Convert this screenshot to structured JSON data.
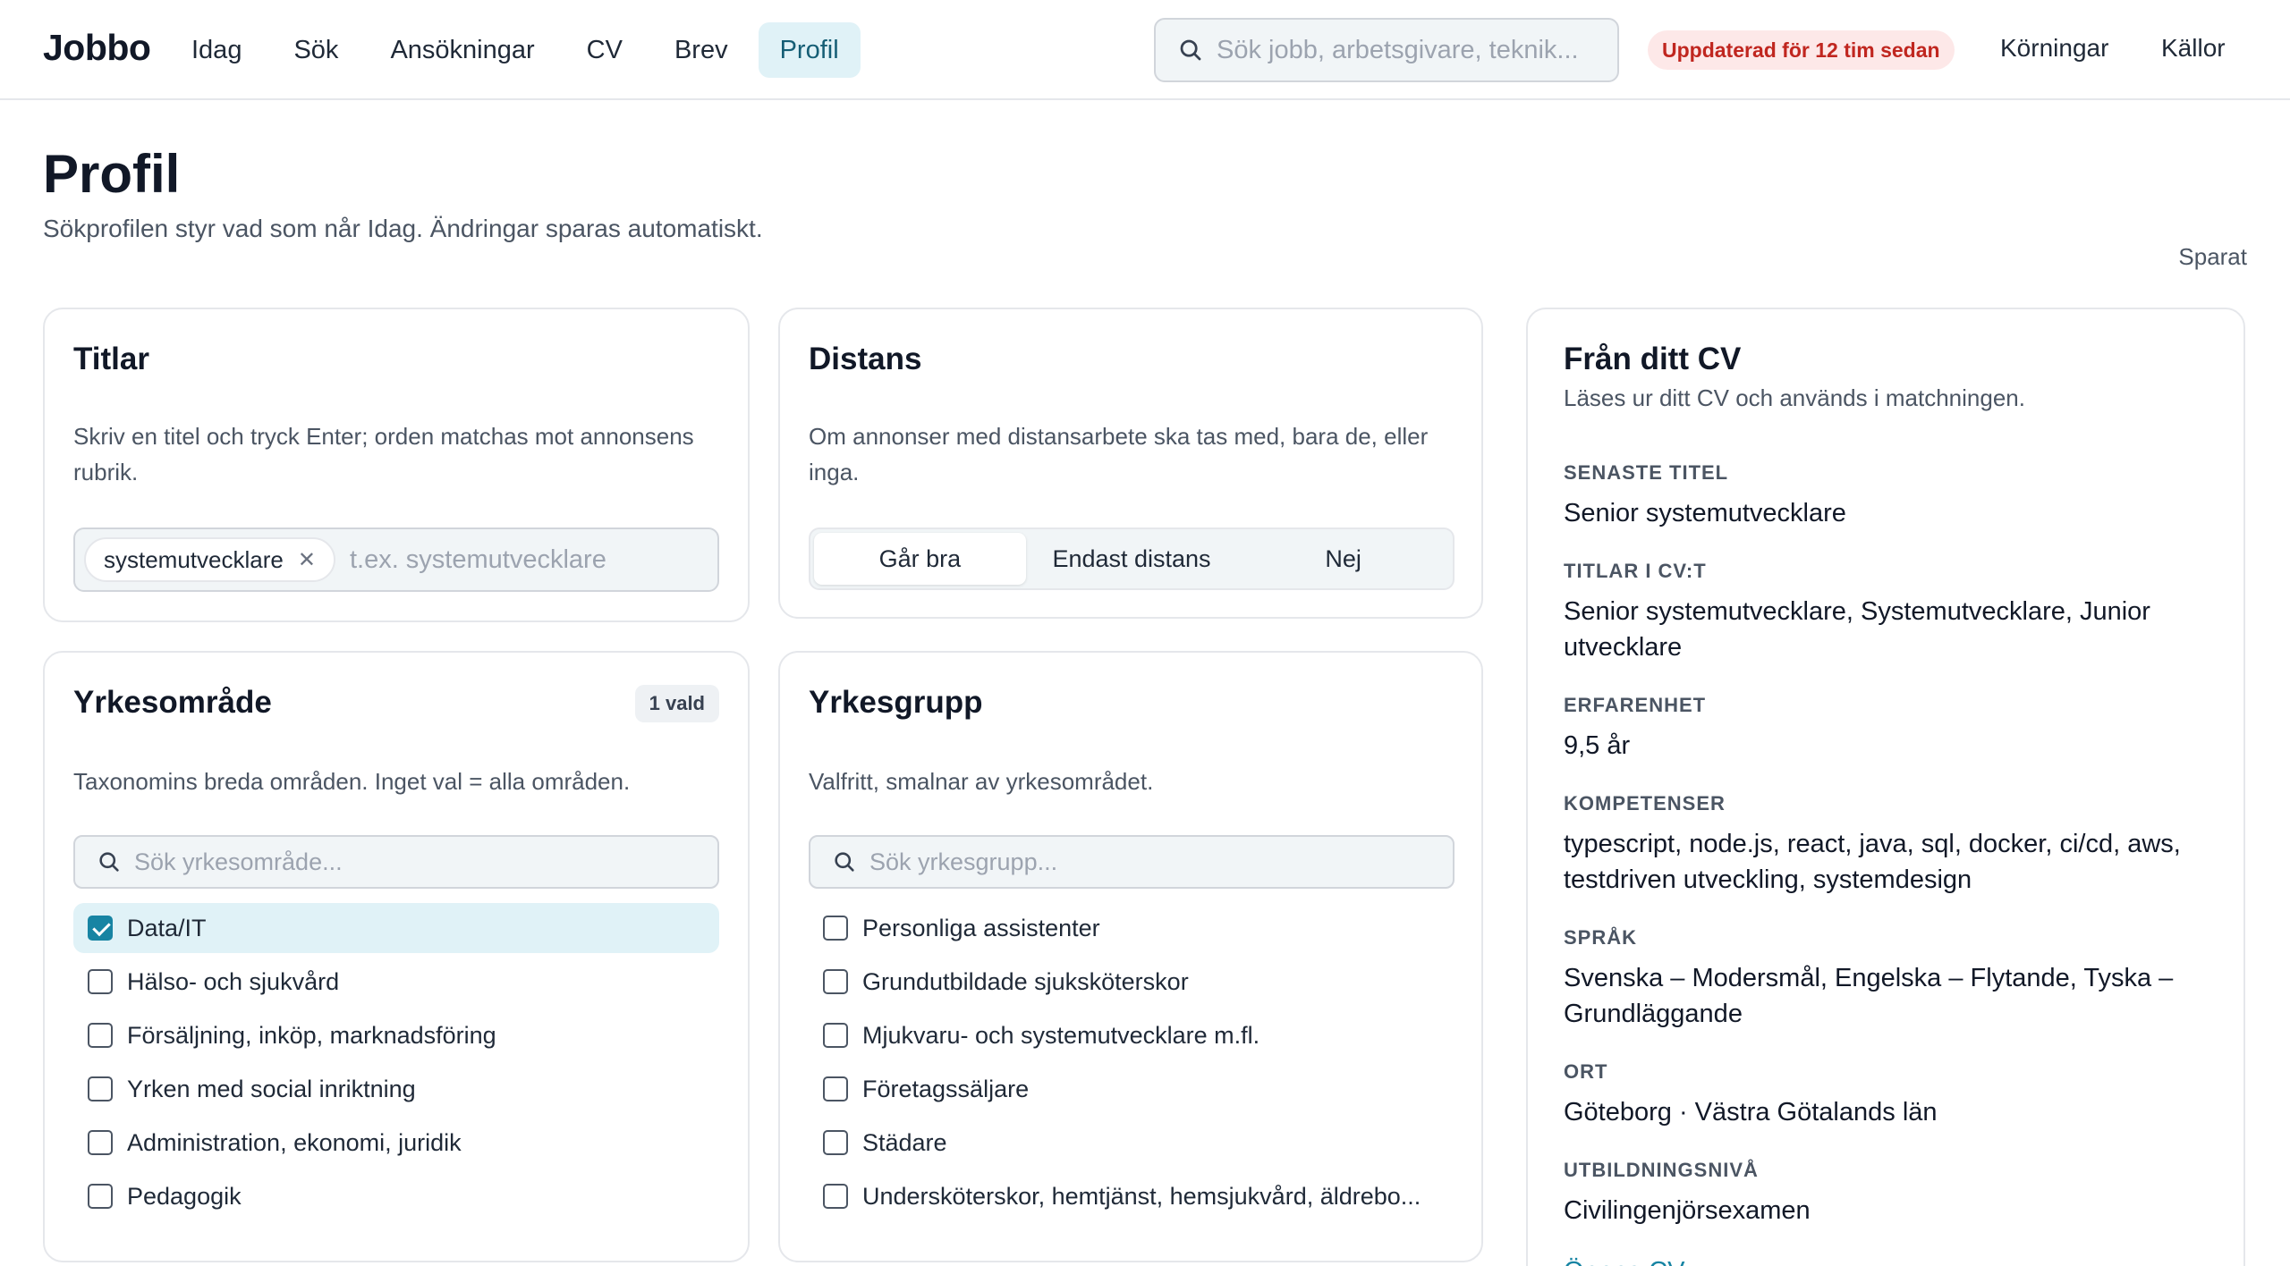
{
  "brand": "Jobbo",
  "nav": [
    {
      "label": "Idag",
      "active": false
    },
    {
      "label": "Sök",
      "active": false
    },
    {
      "label": "Ansökningar",
      "active": false
    },
    {
      "label": "CV",
      "active": false
    },
    {
      "label": "Brev",
      "active": false
    },
    {
      "label": "Profil",
      "active": true
    }
  ],
  "search": {
    "placeholder": "Sök jobb, arbetsgivare, teknik...",
    "icon": "search-icon"
  },
  "status": {
    "text": "Uppdaterad för 12 tim sedan",
    "bg": "#fde8e8",
    "color": "#c0261f"
  },
  "top_links": {
    "runs": "Körningar",
    "sources": "Källor"
  },
  "header": {
    "title": "Profil",
    "subtitle": "Sökprofilen styr vad som når Idag. Ändringar sparas automatiskt.",
    "saved": "Sparat"
  },
  "titles_card": {
    "title": "Titlar",
    "desc": "Skriv en titel och tryck Enter; orden matchas mot annonsens rubrik.",
    "chips": [
      "systemutvecklare"
    ],
    "placeholder": "t.ex. systemutvecklare"
  },
  "remote_card": {
    "title": "Distans",
    "desc": "Om annonser med distansarbete ska tas med, bara de, eller inga.",
    "options": [
      "Går bra",
      "Endast distans",
      "Nej"
    ],
    "selected": "Går bra"
  },
  "area_card": {
    "title": "Yrkesområde",
    "badge": "1 vald",
    "desc": "Taxonomins breda områden. Inget val = alla områden.",
    "placeholder": "Sök yrkesområde...",
    "items": [
      {
        "label": "Data/IT",
        "checked": true
      },
      {
        "label": "Hälso- och sjukvård",
        "checked": false
      },
      {
        "label": "Försäljning, inköp, marknadsföring",
        "checked": false
      },
      {
        "label": "Yrken med social inriktning",
        "checked": false
      },
      {
        "label": "Administration, ekonomi, juridik",
        "checked": false
      },
      {
        "label": "Pedagogik",
        "checked": false
      }
    ]
  },
  "group_card": {
    "title": "Yrkesgrupp",
    "desc": "Valfritt, smalnar av yrkesområdet.",
    "placeholder": "Sök yrkesgrupp...",
    "items": [
      {
        "label": "Personliga assistenter",
        "checked": false
      },
      {
        "label": "Grundutbildade sjuksköterskor",
        "checked": false
      },
      {
        "label": "Mjukvaru- och systemutvecklare m.fl.",
        "checked": false
      },
      {
        "label": "Företagssäljare",
        "checked": false
      },
      {
        "label": "Städare",
        "checked": false
      },
      {
        "label": "Undersköterskor, hemtjänst, hemsjukvård, äldrebo...",
        "checked": false
      }
    ]
  },
  "cv_card": {
    "title": "Från ditt CV",
    "subtitle": "Läses ur ditt CV och används i matchningen.",
    "fields": [
      {
        "label": "Senaste titel",
        "value": "Senior systemutvecklare"
      },
      {
        "label": "Titlar i CV:t",
        "value": "Senior systemutvecklare, Systemutvecklare, Junior utvecklare"
      },
      {
        "label": "Erfarenhet",
        "value": "9,5 år"
      },
      {
        "label": "Kompetenser",
        "value": "typescript, node.js, react, java, sql, docker, ci/cd, aws, testdriven utveckling, systemdesign"
      },
      {
        "label": "Språk",
        "value": "Svenska – Modersmål, Engelska – Flytande, Tyska – Grundläggande"
      },
      {
        "label": "Ort",
        "value": "Göteborg · Västra Götalands län"
      },
      {
        "label": "Utbildningsnivå",
        "value": "Civilingenjörsexamen"
      }
    ],
    "link": "Öppna CV"
  },
  "colors": {
    "accent": "#1784a3",
    "active_nav_bg": "#e0f2f7",
    "active_nav_text": "#155e75"
  }
}
